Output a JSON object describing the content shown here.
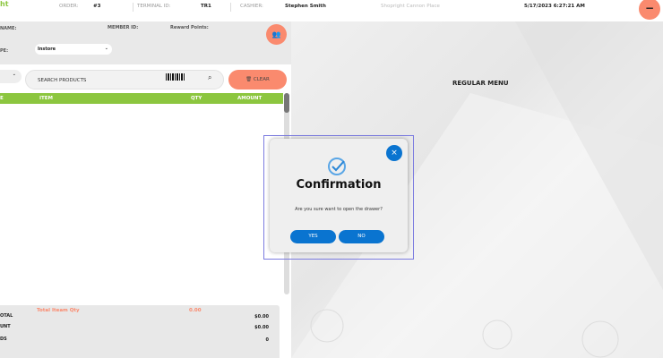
{
  "header": {
    "logo_fragment": "ht",
    "order_label": "ORDER:",
    "order_value": "#3",
    "terminal_label": "TERMINAL ID:",
    "terminal_value": "TR1",
    "cashier_label": "CASHIER:",
    "cashier_value": "Stephen Smith",
    "store": "Shopright Cannon Place",
    "datetime": "5/17/2023 6:27:21 AM"
  },
  "customer": {
    "name_label": "NAME:",
    "member_label": "MEMBER ID:",
    "reward_label": "Reward Points:",
    "type_label": "PE:",
    "type_value": "Instore"
  },
  "search": {
    "placeholder": "SEARCH PRODUCTS",
    "clear": "CLEAR"
  },
  "table": {
    "columns": [
      "E",
      "ITEM",
      "QTY",
      "AMOUNT"
    ]
  },
  "summary": {
    "qty_label": "Total Iteam Qty",
    "qty_value": "0.00",
    "rows": [
      {
        "label": "OTAL",
        "value": "$0.00"
      },
      {
        "label": "UNT",
        "value": "$0.00"
      },
      {
        "label": "DS",
        "value": "0"
      }
    ]
  },
  "menu": {
    "title": "REGULAR MENU"
  },
  "dialog": {
    "title": "Confirmation",
    "message": "Are you sure want to open the drawer?",
    "yes": "YES",
    "no": "NO"
  },
  "colors": {
    "accent": "#fa8a6e",
    "green": "#8cc63f",
    "blue": "#0a74d0"
  }
}
